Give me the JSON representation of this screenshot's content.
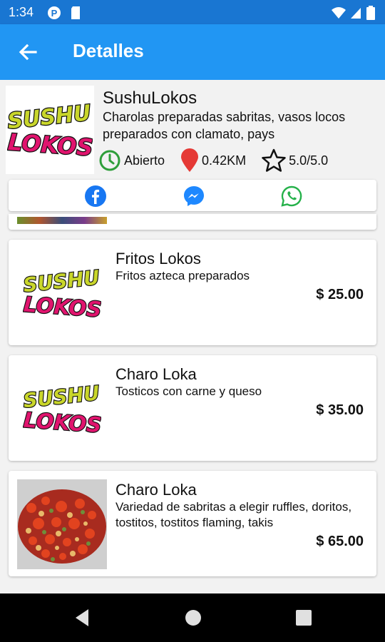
{
  "status_bar": {
    "time": "1:34"
  },
  "app_bar": {
    "title": "Detalles",
    "back_icon": "arrow-left-icon"
  },
  "store": {
    "name": "SushuLokos",
    "description": "Charolas preparadas sabritas, vasos locos preparados con clamato, pays",
    "status": "Abierto",
    "distance": "0.42KM",
    "rating": "5.0/5.0",
    "logo_lines": [
      "SUSHU",
      "LOKOS"
    ]
  },
  "social": [
    "facebook-icon",
    "messenger-icon",
    "whatsapp-icon"
  ],
  "products": [
    {
      "name": "Fritos Lokos",
      "description": "Fritos azteca preparados",
      "price": "$ 25.00",
      "image": "logo"
    },
    {
      "name": "Charo Loka",
      "description": "Tosticos con carne y queso",
      "price": "$ 35.00",
      "image": "logo"
    },
    {
      "name": "Charo Loka",
      "description": "Variedad de sabritas a elegir ruffles, doritos, tostitos, tostitos flaming, takis",
      "price": "$ 65.00",
      "image": "photo"
    }
  ],
  "colors": {
    "app_bar": "#2196f3",
    "status_bar": "#1976d2",
    "open_green": "#2e9e3a",
    "pin_red": "#e53935",
    "facebook": "#1877f2",
    "messenger": "#1e88ff",
    "whatsapp": "#25b14a",
    "logo_yellow": "#c9d62b",
    "logo_pink": "#e0146e"
  }
}
